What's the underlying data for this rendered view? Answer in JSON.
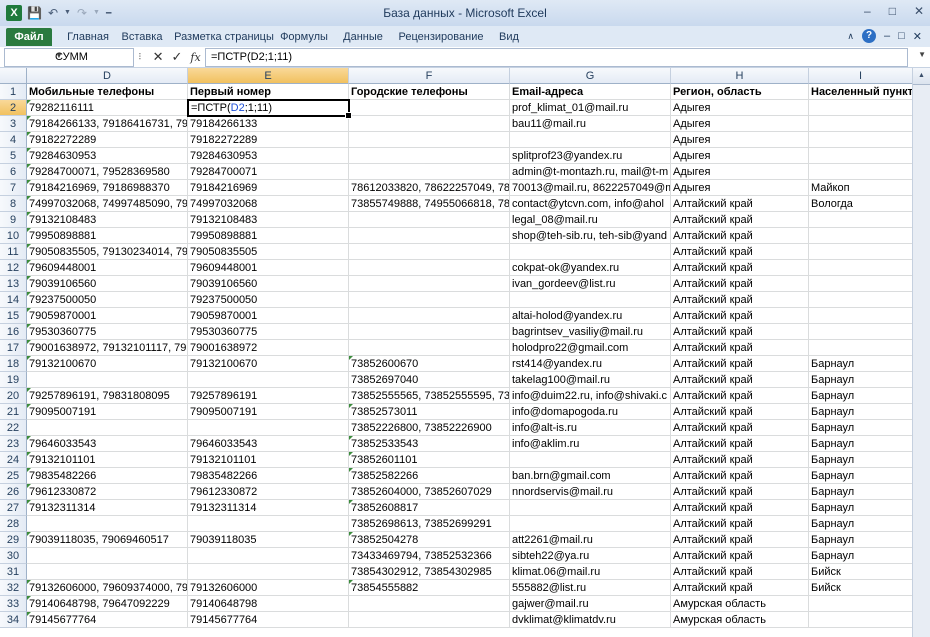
{
  "window": {
    "title": "База данных  -  Microsoft Excel",
    "app_icon": "X"
  },
  "ribbon": {
    "tabs": [
      "Файл",
      "Главная",
      "Вставка",
      "Разметка страницы",
      "Формулы",
      "Данные",
      "Рецензирование",
      "Вид"
    ]
  },
  "formula_bar": {
    "name_box": "СУММ",
    "formula": "=ПСТР(D2;1;11)"
  },
  "columns": [
    {
      "letter": "D",
      "header": "Мобильные телефоны"
    },
    {
      "letter": "E",
      "header": "Первый номер"
    },
    {
      "letter": "F",
      "header": "Городские телефоны"
    },
    {
      "letter": "G",
      "header": "Email-адреса"
    },
    {
      "letter": "H",
      "header": "Регион, область"
    },
    {
      "letter": "I",
      "header": "Населенный пункт"
    }
  ],
  "active_cell": {
    "prefix": "=ПСТР(",
    "ref": "D2",
    "suffix": ";1;11)"
  },
  "rows": [
    {
      "n": "2",
      "D": "79282116111",
      "E": "",
      "F": "",
      "G": "prof_klimat_01@mail.ru",
      "H": "Адыгея",
      "I": ""
    },
    {
      "n": "3",
      "D": "79184266133, 79186416731, 79882",
      "E": "79184266133",
      "F": "",
      "G": "bau11@mail.ru",
      "H": "Адыгея",
      "I": ""
    },
    {
      "n": "4",
      "D": "79182272289",
      "E": "79182272289",
      "F": "",
      "G": "",
      "H": "Адыгея",
      "I": ""
    },
    {
      "n": "5",
      "D": "79284630953",
      "E": "79284630953",
      "F": "",
      "G": "splitprof23@yandex.ru",
      "H": "Адыгея",
      "I": ""
    },
    {
      "n": "6",
      "D": "79284700071, 79528369580",
      "E": "79284700071",
      "F": "",
      "G": "admin@t-montazh.ru, mail@t-m",
      "H": "Адыгея",
      "I": ""
    },
    {
      "n": "7",
      "D": "79184216969, 79186988370",
      "E": "79184216969",
      "F": "78612033820, 78622257049, 78771",
      "G": "70013@mail.ru, 8622257049@m",
      "H": "Адыгея",
      "I": "Майкоп"
    },
    {
      "n": "8",
      "D": "74997032068, 74997485090, 79131",
      "E": "74997032068",
      "F": "73855749888, 74955066818, 78172",
      "G": "contact@ytcvn.com, info@ahol",
      "H": "Алтайский край",
      "I": "Вологда"
    },
    {
      "n": "9",
      "D": "79132108483",
      "E": "79132108483",
      "F": "",
      "G": "legal_08@mail.ru",
      "H": "Алтайский край",
      "I": ""
    },
    {
      "n": "10",
      "D": "79950898881",
      "E": "79950898881",
      "F": "",
      "G": "shop@teh-sib.ru, teh-sib@yand",
      "H": "Алтайский край",
      "I": ""
    },
    {
      "n": "11",
      "D": "79050835505, 79130234014, 79131",
      "E": "79050835505",
      "F": "",
      "G": "",
      "H": "Алтайский край",
      "I": ""
    },
    {
      "n": "12",
      "D": "79609448001",
      "E": "79609448001",
      "F": "",
      "G": "cokpat-ok@yandex.ru",
      "H": "Алтайский край",
      "I": ""
    },
    {
      "n": "13",
      "D": "79039106560",
      "E": "79039106560",
      "F": "",
      "G": "ivan_gordeev@list.ru",
      "H": "Алтайский край",
      "I": ""
    },
    {
      "n": "14",
      "D": "79237500050",
      "E": "79237500050",
      "F": "",
      "G": "",
      "H": "Алтайский край",
      "I": ""
    },
    {
      "n": "15",
      "D": "79059870001",
      "E": "79059870001",
      "F": "",
      "G": "altai-holod@yandex.ru",
      "H": "Алтайский край",
      "I": ""
    },
    {
      "n": "16",
      "D": "79530360775",
      "E": "79530360775",
      "F": "",
      "G": "bagrintsev_vasiliy@mail.ru",
      "H": "Алтайский край",
      "I": ""
    },
    {
      "n": "17",
      "D": "79001638972, 79132101117, 79131",
      "E": "79001638972",
      "F": "",
      "G": "holodpro22@gmail.com",
      "H": "Алтайский край",
      "I": ""
    },
    {
      "n": "18",
      "D": "79132100670",
      "E": "79132100670",
      "F": "73852600670",
      "G": "rst414@yandex.ru",
      "H": "Алтайский край",
      "I": "Барнаул"
    },
    {
      "n": "19",
      "D": "",
      "E": "",
      "F": "73852697040",
      "G": "takelag100@mail.ru",
      "H": "Алтайский край",
      "I": "Барнаул"
    },
    {
      "n": "20",
      "D": "79257896191, 79831808095",
      "E": "79257896191",
      "F": "73852555565, 73852555595, 73852",
      "G": "info@duim22.ru, info@shivaki.c",
      "H": "Алтайский край",
      "I": "Барнаул"
    },
    {
      "n": "21",
      "D": "79095007191",
      "E": "79095007191",
      "F": "73852573011",
      "G": "info@domapogoda.ru",
      "H": "Алтайский край",
      "I": "Барнаул"
    },
    {
      "n": "22",
      "D": "",
      "E": "",
      "F": "73852226800, 73852226900",
      "G": "info@alt-is.ru",
      "H": "Алтайский край",
      "I": "Барнаул"
    },
    {
      "n": "23",
      "D": "79646033543",
      "E": "79646033543",
      "F": "73852533543",
      "G": "info@aklim.ru",
      "H": "Алтайский край",
      "I": "Барнаул"
    },
    {
      "n": "24",
      "D": "79132101101",
      "E": "79132101101",
      "F": "73852601101",
      "G": "",
      "H": "Алтайский край",
      "I": "Барнаул"
    },
    {
      "n": "25",
      "D": "79835482266",
      "E": "79835482266",
      "F": "73852582266",
      "G": "ban.brn@gmail.com",
      "H": "Алтайский край",
      "I": "Барнаул"
    },
    {
      "n": "26",
      "D": "79612330872",
      "E": "79612330872",
      "F": "73852604000, 73852607029",
      "G": "nnordservis@mail.ru",
      "H": "Алтайский край",
      "I": "Барнаул"
    },
    {
      "n": "27",
      "D": "79132311314",
      "E": "79132311314",
      "F": "73852608817",
      "G": "",
      "H": "Алтайский край",
      "I": "Барнаул"
    },
    {
      "n": "28",
      "D": "",
      "E": "",
      "F": "73852698613, 73852699291",
      "G": "",
      "H": "Алтайский край",
      "I": "Барнаул"
    },
    {
      "n": "29",
      "D": "79039118035, 79069460517",
      "E": "79039118035",
      "F": "73852504278",
      "G": "att2261@mail.ru",
      "H": "Алтайский край",
      "I": "Барнаул"
    },
    {
      "n": "30",
      "D": "",
      "E": "",
      "F": "73433469794, 73852532366",
      "G": "sibteh22@ya.ru",
      "H": "Алтайский край",
      "I": "Барнаул"
    },
    {
      "n": "31",
      "D": "",
      "E": "",
      "F": "73854302912, 73854302985",
      "G": "klimat.06@mail.ru",
      "H": "Алтайский край",
      "I": "Бийск"
    },
    {
      "n": "32",
      "D": "79132606000, 79609374000, 79631",
      "E": "79132606000",
      "F": "73854555882",
      "G": "555882@list.ru",
      "H": "Алтайский край",
      "I": "Бийск"
    },
    {
      "n": "33",
      "D": "79140648798, 79647092229",
      "E": "79140648798",
      "F": "",
      "G": "gajwer@mail.ru",
      "H": "Амурская область",
      "I": ""
    },
    {
      "n": "34",
      "D": "79145677764",
      "E": "79145677764",
      "F": "",
      "G": "dvklimat@klimatdv.ru",
      "H": "Амурская область",
      "I": ""
    }
  ],
  "row1_label": "1"
}
